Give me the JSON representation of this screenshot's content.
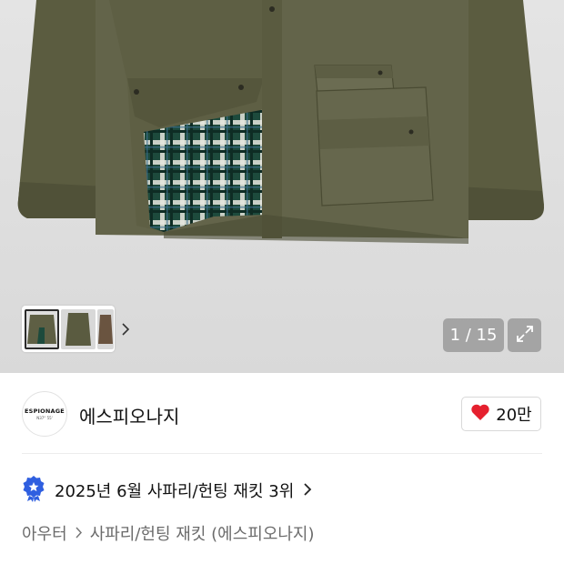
{
  "gallery": {
    "counter": "1 / 15",
    "icons": {
      "next": "chevron-right-icon",
      "expand": "expand-icon"
    }
  },
  "brand": {
    "logo_text": "ESPIONAGE",
    "logo_subtext": "N37° 55'",
    "name": "에스피오나지",
    "like_count": "20만",
    "like_color": "#e5202e"
  },
  "ranking": {
    "text": "2025년 6월 사파리/헌팅 재킷 3위",
    "badge_color": "#2f5fe0"
  },
  "breadcrumb": {
    "items": [
      "아우터",
      "사파리/헌팅 재킷 (에스피오나지)"
    ]
  }
}
